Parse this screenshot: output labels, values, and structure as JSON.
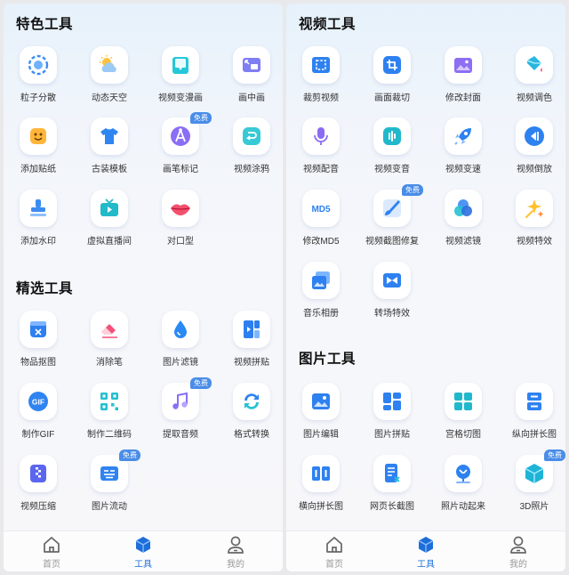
{
  "left": {
    "sections": [
      {
        "title": "特色工具",
        "tools": [
          {
            "label": "粒子分散",
            "icon": "particle-icon",
            "badge": ""
          },
          {
            "label": "动态天空",
            "icon": "sky-weather-icon",
            "badge": ""
          },
          {
            "label": "视频变漫画",
            "icon": "comic-book-icon",
            "badge": ""
          },
          {
            "label": "画中画",
            "icon": "picture-in-picture-icon",
            "badge": ""
          },
          {
            "label": "添加贴纸",
            "icon": "sticker-face-icon",
            "badge": ""
          },
          {
            "label": "古装模板",
            "icon": "costume-shirt-icon",
            "badge": ""
          },
          {
            "label": "画笔标记",
            "icon": "compass-pen-icon",
            "badge": "免费"
          },
          {
            "label": "视频涂鸦",
            "icon": "doodle-icon",
            "badge": ""
          },
          {
            "label": "添加水印",
            "icon": "stamp-icon",
            "badge": ""
          },
          {
            "label": "虚拟直播间",
            "icon": "tv-live-icon",
            "badge": ""
          },
          {
            "label": "对口型",
            "icon": "lips-icon",
            "badge": ""
          }
        ]
      },
      {
        "title": "精选工具",
        "tools": [
          {
            "label": "物品抠图",
            "icon": "cutout-icon",
            "badge": ""
          },
          {
            "label": "消除笔",
            "icon": "eraser-icon",
            "badge": ""
          },
          {
            "label": "图片滤镜",
            "icon": "droplet-icon",
            "badge": ""
          },
          {
            "label": "视频拼贴",
            "icon": "collage-icon",
            "badge": ""
          },
          {
            "label": "制作GIF",
            "icon": "gif-icon",
            "badge": ""
          },
          {
            "label": "制作二维码",
            "icon": "qr-code-icon",
            "badge": ""
          },
          {
            "label": "提取音频",
            "icon": "music-note-icon",
            "badge": "免费"
          },
          {
            "label": "格式转换",
            "icon": "convert-arrows-icon",
            "badge": ""
          },
          {
            "label": "视频压缩",
            "icon": "compress-icon",
            "badge": ""
          },
          {
            "label": "图片流动",
            "icon": "flow-icon",
            "badge": "免费"
          }
        ]
      }
    ]
  },
  "right": {
    "sections": [
      {
        "title": "视频工具",
        "tools": [
          {
            "label": "裁剪视频",
            "icon": "crop-video-icon",
            "badge": ""
          },
          {
            "label": "画面裁切",
            "icon": "crop-icon",
            "badge": ""
          },
          {
            "label": "修改封面",
            "icon": "cover-image-icon",
            "badge": ""
          },
          {
            "label": "视频调色",
            "icon": "paint-bucket-icon",
            "badge": ""
          },
          {
            "label": "视频配音",
            "icon": "microphone-icon",
            "badge": ""
          },
          {
            "label": "视频变音",
            "icon": "voice-wave-icon",
            "badge": ""
          },
          {
            "label": "视频变速",
            "icon": "rocket-icon",
            "badge": ""
          },
          {
            "label": "视频倒放",
            "icon": "rewind-icon",
            "badge": ""
          },
          {
            "label": "修改MD5",
            "icon": "md5-icon",
            "badge": ""
          },
          {
            "label": "视频截图修复",
            "icon": "brush-repair-icon",
            "badge": "免费"
          },
          {
            "label": "视频滤镜",
            "icon": "filter-circles-icon",
            "badge": ""
          },
          {
            "label": "视频特效",
            "icon": "sparkle-wand-icon",
            "badge": ""
          },
          {
            "label": "音乐相册",
            "icon": "photo-album-icon",
            "badge": ""
          },
          {
            "label": "转场特效",
            "icon": "transition-icon",
            "badge": ""
          }
        ]
      },
      {
        "title": "图片工具",
        "tools": [
          {
            "label": "图片编辑",
            "icon": "image-edit-icon",
            "badge": ""
          },
          {
            "label": "图片拼贴",
            "icon": "image-collage-icon",
            "badge": ""
          },
          {
            "label": "宫格切图",
            "icon": "grid-cut-icon",
            "badge": ""
          },
          {
            "label": "纵向拼长图",
            "icon": "vertical-stitch-icon",
            "badge": ""
          },
          {
            "label": "横向拼长图",
            "icon": "horizontal-stitch-icon",
            "badge": ""
          },
          {
            "label": "网页长截图",
            "icon": "webpage-screenshot-icon",
            "badge": ""
          },
          {
            "label": "照片动起来",
            "icon": "animate-photo-icon",
            "badge": ""
          },
          {
            "label": "3D照片",
            "icon": "cube-3d-icon",
            "badge": "免费"
          }
        ]
      }
    ]
  },
  "tabbar": [
    {
      "label": "首页",
      "icon": "home-icon",
      "active": false
    },
    {
      "label": "工具",
      "icon": "toolbox-cube-icon",
      "active": true
    },
    {
      "label": "我的",
      "icon": "profile-icon",
      "active": false
    }
  ],
  "colors": {
    "accent": "#1d6ed8",
    "badge": "#4a8de8",
    "inactive_tab": "#999999"
  }
}
